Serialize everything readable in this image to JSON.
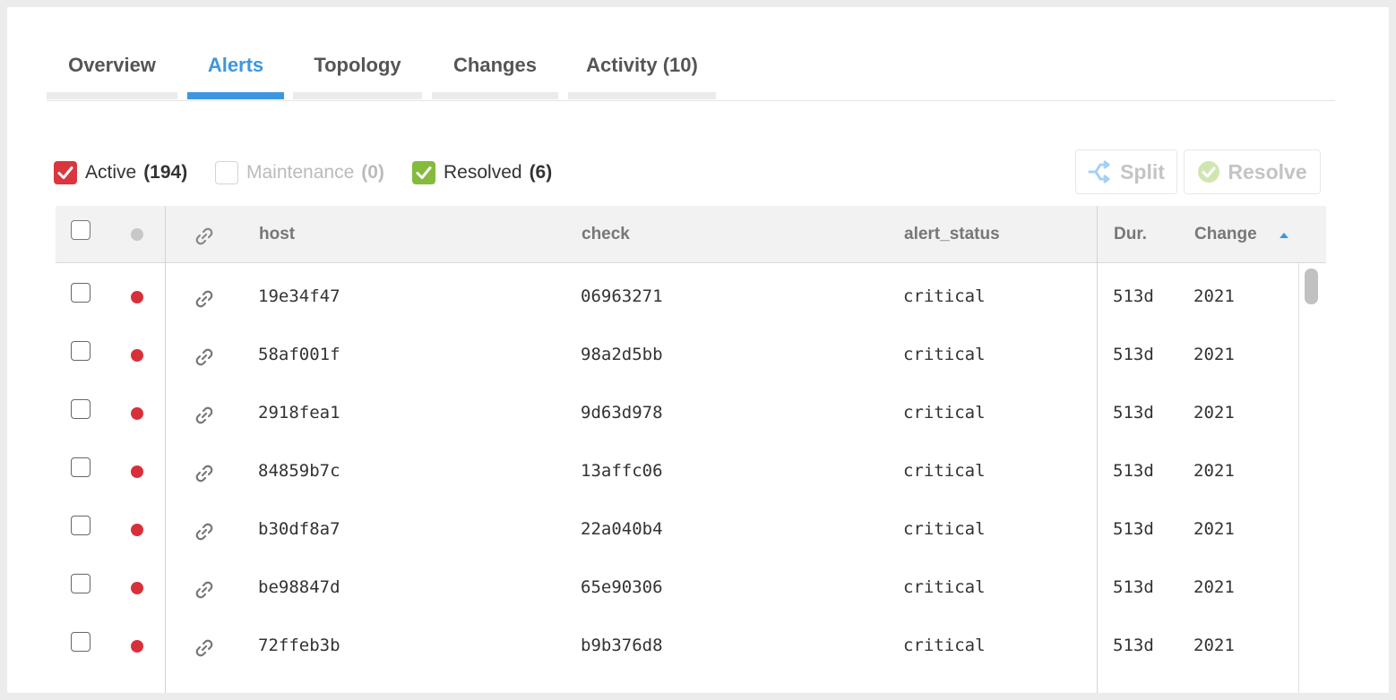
{
  "tabs": [
    {
      "label": "Overview",
      "active": false
    },
    {
      "label": "Alerts",
      "active": true
    },
    {
      "label": "Topology",
      "active": false
    },
    {
      "label": "Changes",
      "active": false
    },
    {
      "label": "Activity (10)",
      "active": false
    }
  ],
  "filters": {
    "active": {
      "label": "Active",
      "count": "(194)",
      "checked": true,
      "color": "#d9363e"
    },
    "maintenance": {
      "label": "Maintenance",
      "count": "(0)",
      "checked": false
    },
    "resolved": {
      "label": "Resolved",
      "count": "(6)",
      "checked": true,
      "color": "#84bb3e"
    }
  },
  "actions": {
    "split_label": "Split",
    "resolve_label": "Resolve"
  },
  "table": {
    "headers": {
      "host": "host",
      "check": "check",
      "alert_status": "alert_status",
      "duration": "Dur.",
      "change": "Change"
    },
    "rows": [
      {
        "host": "19e34f47",
        "check": "06963271",
        "alert_status": "critical",
        "duration": "513d",
        "change": "2021"
      },
      {
        "host": "58af001f",
        "check": "98a2d5bb",
        "alert_status": "critical",
        "duration": "513d",
        "change": "2021"
      },
      {
        "host": "2918fea1",
        "check": "9d63d978",
        "alert_status": "critical",
        "duration": "513d",
        "change": "2021"
      },
      {
        "host": "84859b7c",
        "check": "13affc06",
        "alert_status": "critical",
        "duration": "513d",
        "change": "2021"
      },
      {
        "host": "b30df8a7",
        "check": "22a040b4",
        "alert_status": "critical",
        "duration": "513d",
        "change": "2021"
      },
      {
        "host": "be98847d",
        "check": "65e90306",
        "alert_status": "critical",
        "duration": "513d",
        "change": "2021"
      },
      {
        "host": "72ffeb3b",
        "check": "b9b376d8",
        "alert_status": "critical",
        "duration": "513d",
        "change": "2021"
      }
    ]
  },
  "colors": {
    "accent": "#3d97e0",
    "critical": "#d8303a"
  }
}
